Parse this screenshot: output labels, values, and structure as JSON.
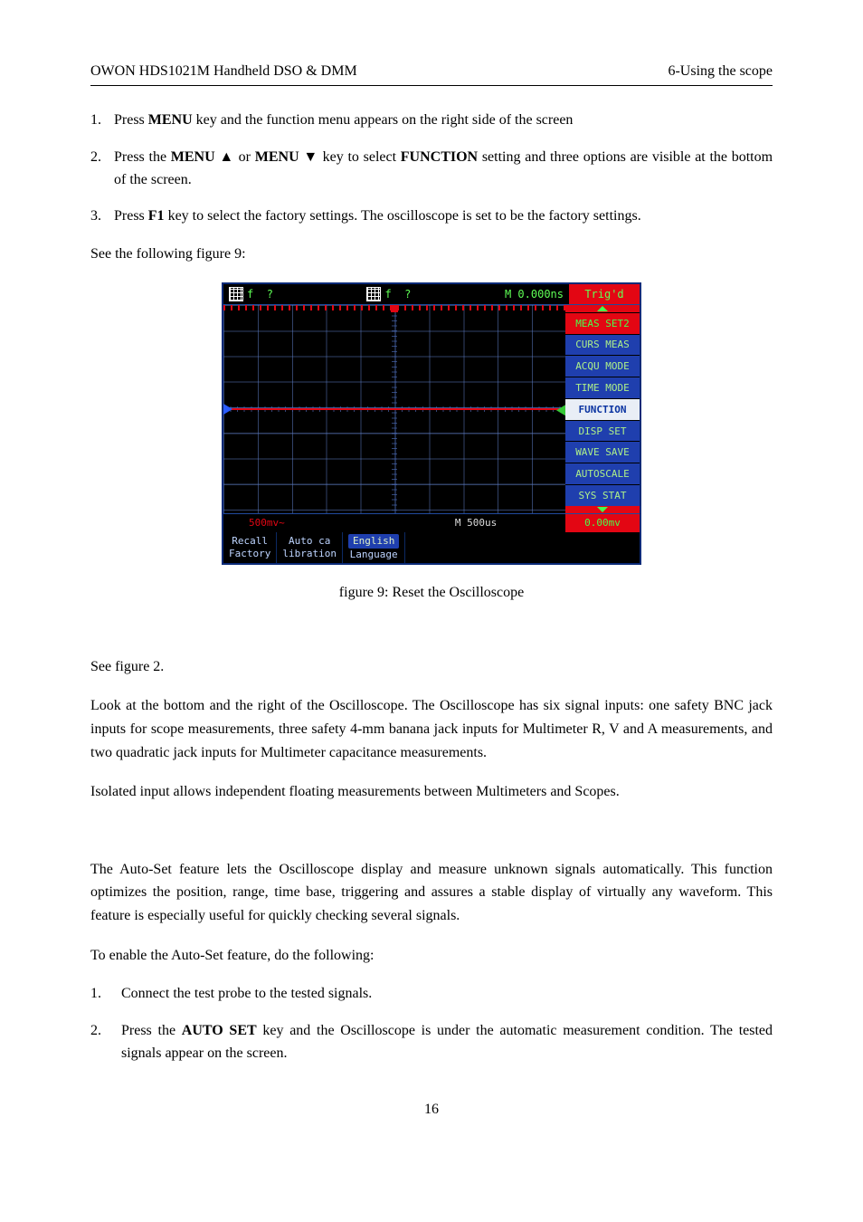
{
  "header": {
    "left": "OWON    HDS1021M Handheld DSO & DMM",
    "right": "6-Using the scope"
  },
  "list1": {
    "items": [
      {
        "num": "1.",
        "html": "Press <b>MENU</b> key and the function menu appears on the right side of the screen"
      },
      {
        "num": "2.",
        "html": "Press the <b>MENU  ▲</b> or <b>MENU  ▼</b> key to select <b>FUNCTION</b> setting and three options are visible at the bottom of the screen."
      },
      {
        "num": "3.",
        "html": "Press <b>F1</b> key to select the factory settings. The oscilloscope is set to be the factory settings."
      }
    ]
  },
  "after_list1": "See the following figure 9:",
  "scope": {
    "top": {
      "ch1": {
        "glyph": "f",
        "val": "?"
      },
      "ch2": {
        "glyph": "f",
        "val": "?"
      },
      "m": "M  0.000ns",
      "trig": "Trig'd"
    },
    "menu": [
      {
        "label": "MEAS SET2",
        "cls": "mred"
      },
      {
        "label": "CURS MEAS",
        "cls": "mblue"
      },
      {
        "label": "ACQU MODE",
        "cls": "mblue"
      },
      {
        "label": "TIME MODE",
        "cls": "mblue"
      },
      {
        "label": "FUNCTION",
        "cls": "mfunc"
      },
      {
        "label": "DISP SET",
        "cls": "mblue"
      },
      {
        "label": "WAVE SAVE",
        "cls": "mblue"
      },
      {
        "label": "AUTOSCALE",
        "cls": "mblue"
      },
      {
        "label": "SYS STAT",
        "cls": "mblue"
      }
    ],
    "bot1": {
      "left": "500mv~",
      "mid": "M 500us",
      "right": "0.00mv"
    },
    "bot2": {
      "f1": {
        "l1": "Recall",
        "l2": "Factory"
      },
      "f2": {
        "l1": "Auto ca",
        "l2": "libration"
      },
      "f3": {
        "l1": "English",
        "l2": "Language"
      }
    }
  },
  "caption": "figure 9: Reset the Oscilloscope",
  "see_fig2": "See figure 2.",
  "para_inputs": "Look at the bottom and the right of the Oscilloscope. The Oscilloscope has six signal inputs: one safety BNC jack inputs for scope measurements, three safety 4-mm banana jack inputs for Multimeter R, V and A measurements, and two quadratic jack inputs for Multimeter capacitance measurements.",
  "para_isolated": "Isolated input allows independent floating measurements between Multimeters and Scopes.",
  "para_autoset1": "The Auto-Set feature lets the Oscilloscope display and measure unknown signals automatically. This function optimizes the position, range, time base, triggering and assures a stable display of virtually any waveform. This feature is especially useful for quickly checking several signals.",
  "para_autoset2": "To enable the Auto-Set feature, do the following:",
  "list2": {
    "items": [
      {
        "num": "1.",
        "html": "Connect the test probe to the tested signals."
      },
      {
        "num": "2.",
        "html": "Press the <b>AUTO SET</b> key and the Oscilloscope is under the automatic measurement condition. The tested signals appear on the screen."
      }
    ]
  },
  "pagenum": "16"
}
